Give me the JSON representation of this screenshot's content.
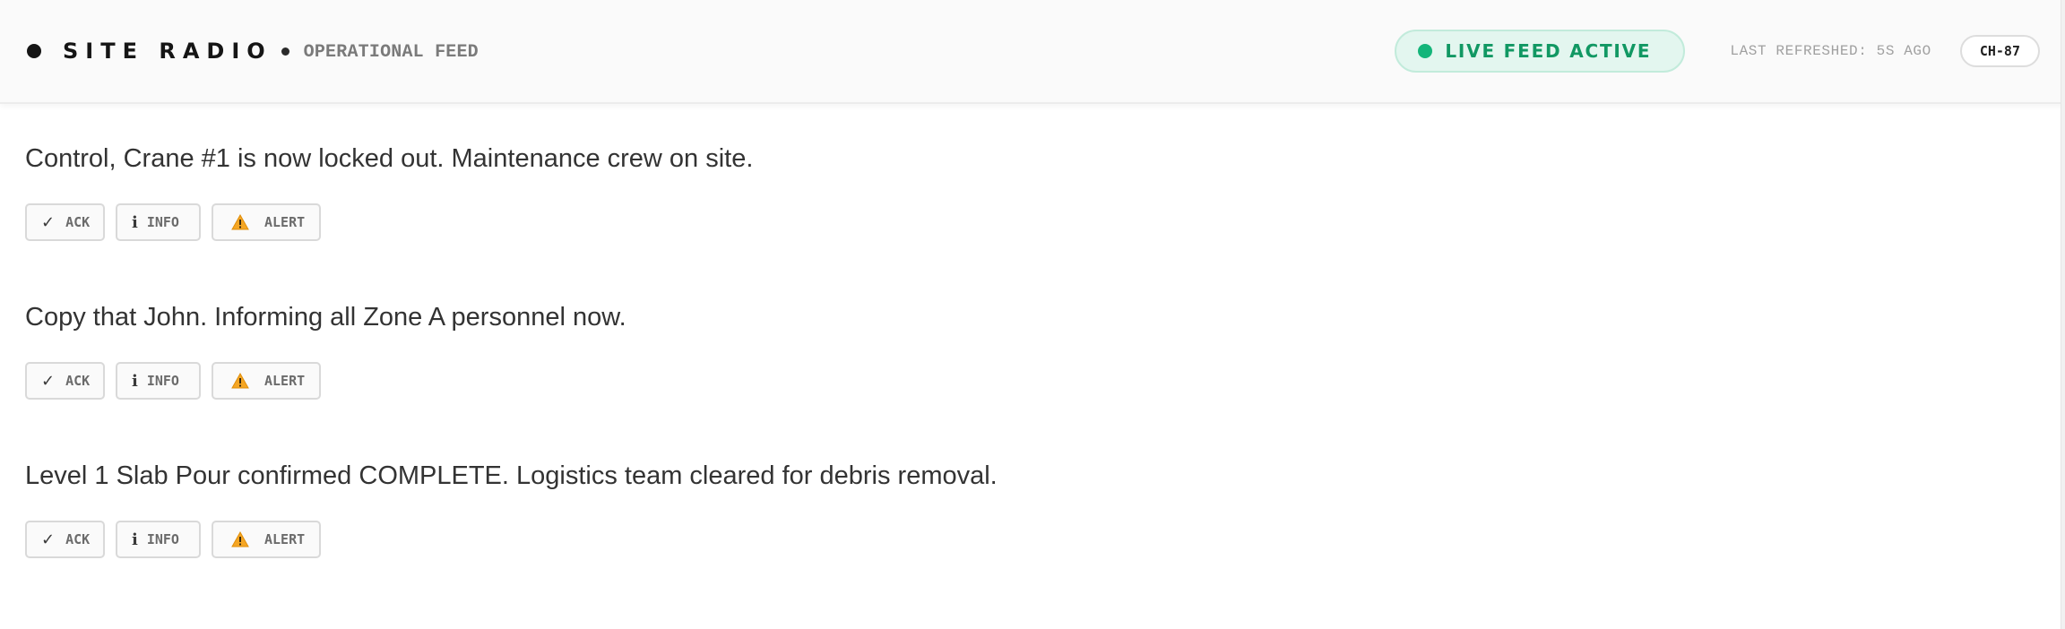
{
  "header": {
    "title": "SITE RADIO",
    "subtitle": "OPERATIONAL FEED",
    "live_status": "LIVE FEED ACTIVE",
    "last_refreshed": "LAST REFRESHED: 5S AGO",
    "channel": "CH-87"
  },
  "colors": {
    "live_green": "#14b57a",
    "live_pill_bg": "#e3f6ef",
    "warning_orange": "#f5a623"
  },
  "feed": {
    "messages": [
      {
        "text": "Control, Crane #1 is now locked out. Maintenance crew on site.",
        "actions": {
          "ack": "ACK",
          "info": "INFO",
          "alert": "ALERT"
        }
      },
      {
        "text": "Copy that John. Informing all Zone A personnel now.",
        "actions": {
          "ack": "ACK",
          "info": "INFO",
          "alert": "ALERT"
        }
      },
      {
        "text": "Level 1 Slab Pour confirmed COMPLETE. Logistics team cleared for debris removal.",
        "actions": {
          "ack": "ACK",
          "info": "INFO",
          "alert": "ALERT"
        }
      }
    ]
  },
  "icons": {
    "ack": "check-icon",
    "info": "info-icon",
    "alert": "warning-icon"
  }
}
